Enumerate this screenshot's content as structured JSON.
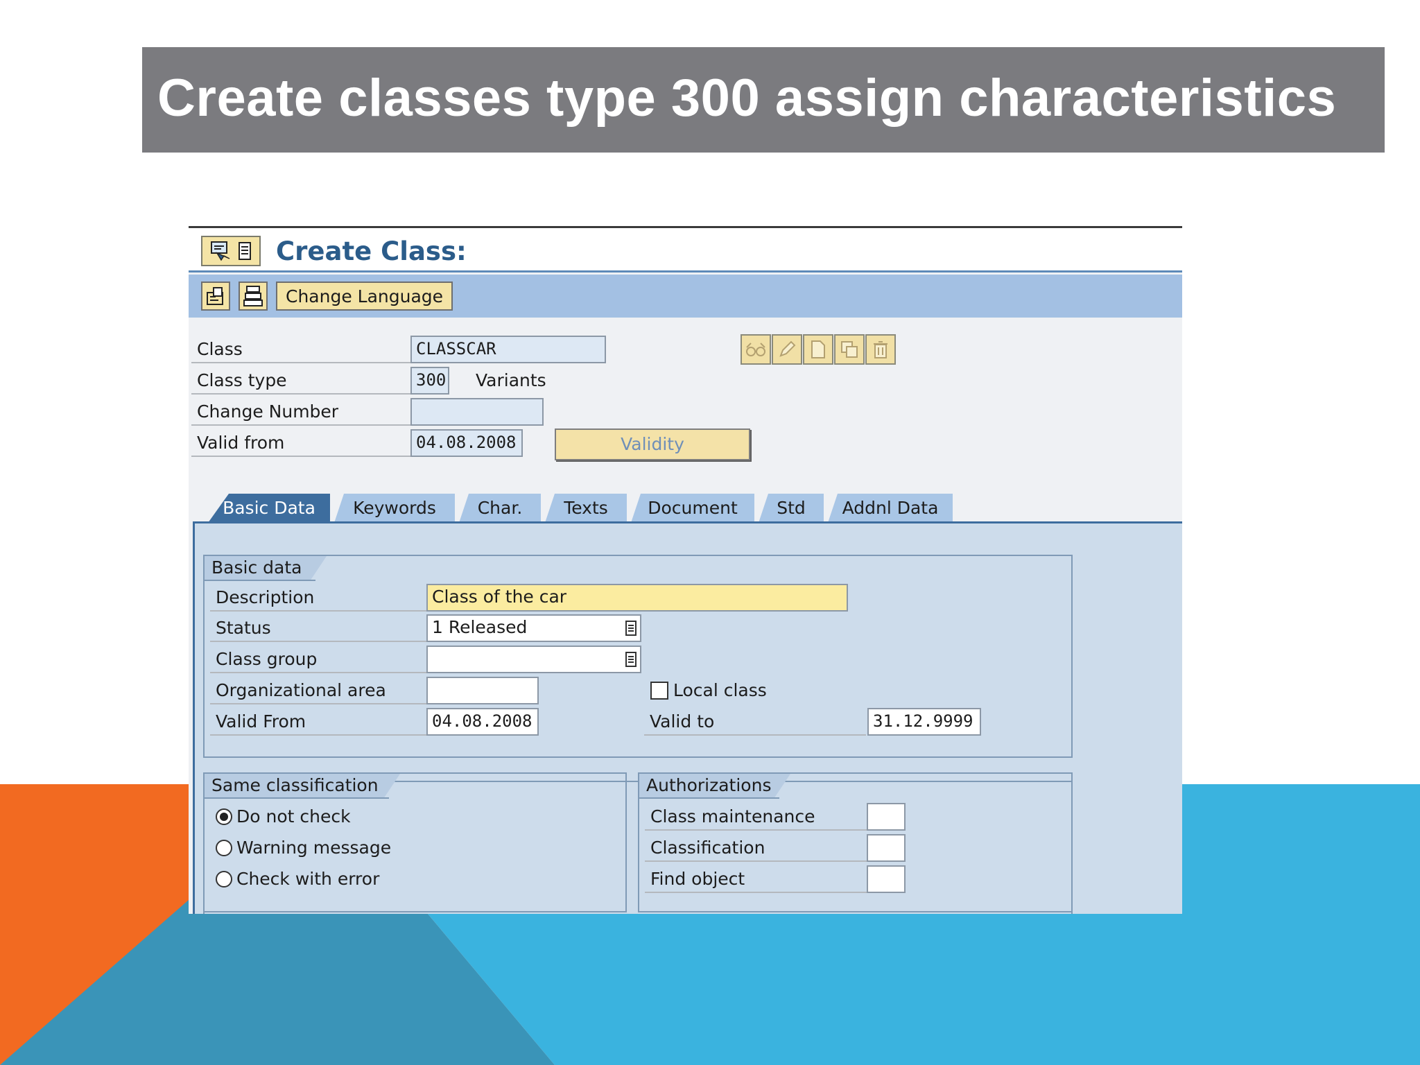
{
  "slide": {
    "title": "Create classes type 300 assign characteristics",
    "colors": {
      "banner": "#7b7b7f",
      "orange": "#f26a21",
      "blue": "#3ab3df",
      "dark_blue": "#3a94b8"
    }
  },
  "sap": {
    "screen_title": "Create Class:",
    "toolbar": {
      "change_language_label": "Change Language"
    },
    "header_fields": {
      "class": {
        "label": "Class",
        "value": "CLASSCAR"
      },
      "class_type": {
        "label": "Class type",
        "value": "300",
        "text": "Variants"
      },
      "change_number": {
        "label": "Change Number",
        "value": ""
      },
      "valid_from": {
        "label": "Valid from",
        "value": "04.08.2008"
      },
      "validity_button": "Validity"
    },
    "header_icons": [
      "glasses-icon",
      "pencil-icon",
      "document-icon",
      "copy-icon",
      "trash-icon"
    ],
    "tabs": [
      {
        "label": "Basic Data",
        "active": true
      },
      {
        "label": "Keywords"
      },
      {
        "label": "Char."
      },
      {
        "label": "Texts"
      },
      {
        "label": "Document"
      },
      {
        "label": "Std"
      },
      {
        "label": "Addnl Data"
      }
    ],
    "basic_data": {
      "group_title": "Basic data",
      "description": {
        "label": "Description",
        "value": "Class of the car"
      },
      "status": {
        "label": "Status",
        "value": "1 Released"
      },
      "class_group": {
        "label": "Class group",
        "value": ""
      },
      "organizational_area": {
        "label": "Organizational area",
        "value": ""
      },
      "local_class": {
        "label": "Local class",
        "checked": false
      },
      "valid_from": {
        "label": "Valid From",
        "value": "04.08.2008"
      },
      "valid_to": {
        "label": "Valid to",
        "value": "31.12.9999"
      }
    },
    "same_classification": {
      "group_title": "Same classification",
      "options": [
        {
          "label": "Do not check",
          "selected": true
        },
        {
          "label": "Warning message",
          "selected": false
        },
        {
          "label": "Check with error",
          "selected": false
        }
      ]
    },
    "authorizations": {
      "group_title": "Authorizations",
      "class_maintenance": {
        "label": "Class maintenance",
        "value": ""
      },
      "classification": {
        "label": "Classification",
        "value": ""
      },
      "find_object": {
        "label": "Find object",
        "value": ""
      }
    }
  }
}
